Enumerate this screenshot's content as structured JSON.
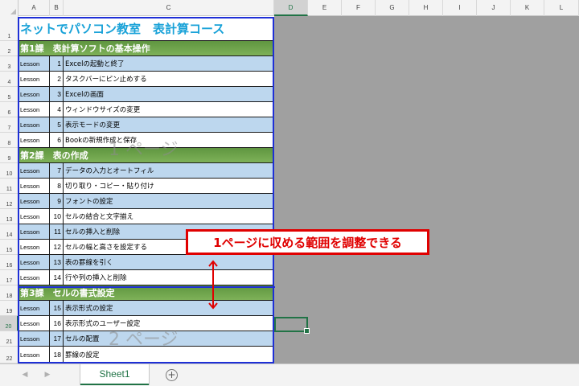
{
  "columns": [
    "A",
    "B",
    "C",
    "D",
    "E",
    "F",
    "G",
    "H",
    "I",
    "J",
    "K",
    "L"
  ],
  "selected_column": "D",
  "selected_row": "20",
  "rows": [
    "1",
    "2",
    "3",
    "4",
    "5",
    "6",
    "7",
    "8",
    "9",
    "10",
    "11",
    "12",
    "13",
    "14",
    "15",
    "16",
    "17",
    "18",
    "19",
    "20",
    "21",
    "22"
  ],
  "title": "ネットでパソコン教室　表計算コース",
  "chapters": [
    "第1課　表計算ソフトの基本操作",
    "第2課　表の作成",
    "第3課　セルの書式設定"
  ],
  "lessons": [
    {
      "label": "Lesson",
      "num": "1",
      "text": "Excelの起動と終了"
    },
    {
      "label": "Lesson",
      "num": "2",
      "text": "タスクバーにピン止めする"
    },
    {
      "label": "Lesson",
      "num": "3",
      "text": "Excelの画面"
    },
    {
      "label": "Lesson",
      "num": "4",
      "text": "ウィンドウサイズの変更"
    },
    {
      "label": "Lesson",
      "num": "5",
      "text": "表示モードの変更"
    },
    {
      "label": "Lesson",
      "num": "6",
      "text": "Bookの新規作成と保存"
    },
    {
      "label": "Lesson",
      "num": "7",
      "text": "データの入力とオートフィル"
    },
    {
      "label": "Lesson",
      "num": "8",
      "text": "切り取り・コピー・貼り付け"
    },
    {
      "label": "Lesson",
      "num": "9",
      "text": "フォントの設定"
    },
    {
      "label": "Lesson",
      "num": "10",
      "text": "セルの結合と文字揃え"
    },
    {
      "label": "Lesson",
      "num": "11",
      "text": "セルの挿入と削除"
    },
    {
      "label": "Lesson",
      "num": "12",
      "text": "セルの幅と高さを設定する"
    },
    {
      "label": "Lesson",
      "num": "13",
      "text": "表の罫線を引く"
    },
    {
      "label": "Lesson",
      "num": "14",
      "text": "行や列の挿入と削除"
    },
    {
      "label": "Lesson",
      "num": "15",
      "text": "表示形式の設定"
    },
    {
      "label": "Lesson",
      "num": "16",
      "text": "表示形式のユーザー設定"
    },
    {
      "label": "Lesson",
      "num": "17",
      "text": "セルの配置"
    },
    {
      "label": "Lesson",
      "num": "18",
      "text": "罫線の設定"
    }
  ],
  "watermarks": {
    "page1": "1 ページ",
    "page2": "2 ページ"
  },
  "callout": "1ページに収める範囲を調整できる",
  "sheet_tab": "Sheet1",
  "add_sheet_symbol": "+",
  "nav_prev": "◀",
  "nav_next": "▶",
  "colors": {
    "accent": "#217346",
    "lesson_blue": "#bdd7ee",
    "chapter_green": "#6ea54a",
    "title_blue": "#19a2d8",
    "print_border": "#1e2fd6",
    "callout_red": "#e00000"
  }
}
